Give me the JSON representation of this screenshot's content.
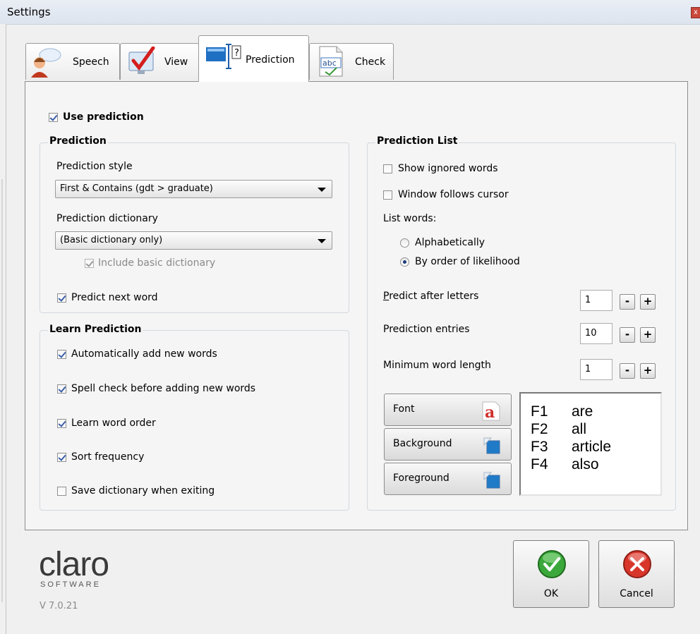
{
  "window": {
    "title": "Settings",
    "close_glyph": "x"
  },
  "tabs": [
    {
      "label": "Speech",
      "icon": "speech-person-icon",
      "active": false
    },
    {
      "label": "View",
      "icon": "monitor-check-icon",
      "active": false
    },
    {
      "label": "Prediction",
      "icon": "prediction-window-icon",
      "active": true
    },
    {
      "label": "Check",
      "icon": "abc-spellcheck-icon",
      "active": false
    }
  ],
  "use_prediction": {
    "label": "Use prediction",
    "checked": true
  },
  "prediction_group": {
    "title": "Prediction",
    "style_label": "Prediction style",
    "style_value": "First & Contains (gdt > graduate)",
    "dictionary_label": "Prediction dictionary",
    "dictionary_value": "(Basic dictionary only)",
    "include_basic": {
      "label": "Include basic dictionary",
      "checked": true,
      "enabled": false
    },
    "predict_next": {
      "label": "Predict next word",
      "checked": true
    }
  },
  "learn_group": {
    "title": "Learn Prediction",
    "options": [
      {
        "label": "Automatically add new words",
        "checked": true
      },
      {
        "label": "Spell check before adding new words",
        "checked": true
      },
      {
        "label": "Learn word order",
        "checked": true
      },
      {
        "label": "Sort frequency",
        "checked": true
      },
      {
        "label": "Save dictionary when exiting",
        "checked": false
      }
    ]
  },
  "list_group": {
    "title": "Prediction List",
    "show_ignored": {
      "label": "Show ignored words",
      "checked": false
    },
    "window_follows": {
      "label": "Window follows cursor",
      "checked": false
    },
    "list_words_label": "List words:",
    "radios": [
      {
        "label": "Alphabetically",
        "selected": false
      },
      {
        "label": "By order of likelihood",
        "selected": true
      }
    ],
    "predict_after": {
      "accel": "P",
      "label_rest": "redict after letters",
      "value": "1"
    },
    "entries": {
      "label": "Prediction entries",
      "value": "10"
    },
    "min_length": {
      "label": "Minimum word length",
      "value": "1"
    },
    "minus": "-",
    "plus": "+",
    "buttons": {
      "font": "Font",
      "background": "Background",
      "foreground": "Foreground"
    },
    "preview": [
      {
        "key": "F1",
        "word": "are"
      },
      {
        "key": "F2",
        "word": "all"
      },
      {
        "key": "F3",
        "word": "article"
      },
      {
        "key": "F4",
        "word": "also"
      }
    ]
  },
  "footer": {
    "logo": "claro",
    "logo_sub": "SOFTWARE",
    "version": "V 7.0.21",
    "ok": "OK",
    "cancel": "Cancel"
  },
  "colors": {
    "ok_green": "#3aa83a",
    "cancel_red": "#d8362b",
    "font_icon_red": "#d0312d",
    "swatch_blue": "#1f7bc8"
  }
}
